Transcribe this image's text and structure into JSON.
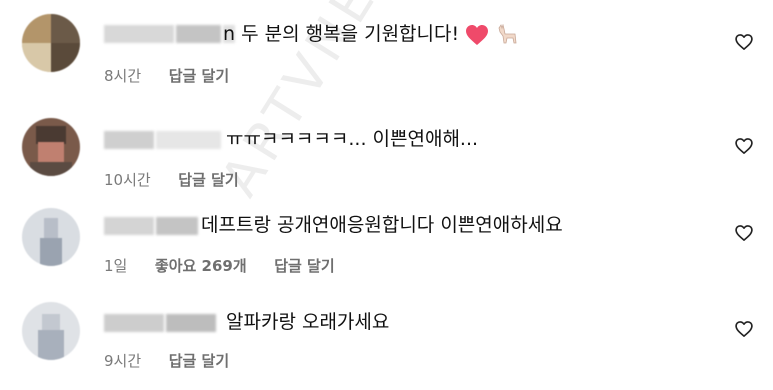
{
  "watermark": "ARTVNEWS",
  "comments": [
    {
      "text": "두 분의 행복을 기원합니다!",
      "username_suffix": "n",
      "time": "8시간",
      "reply_label": "답글 달기",
      "like_icon": "heart-outline-icon"
    },
    {
      "text": "ㅠㅠㅋㅋㅋㅋㅋ... 이쁜연애해...",
      "time": "10시간",
      "reply_label": "답글 달기",
      "like_icon": "heart-outline-icon"
    },
    {
      "text": "데프트랑 공개연애응원합니다 이쁜연애하세요",
      "time": "1일",
      "likes_label": "좋아요 269개",
      "reply_label": "답글 달기",
      "like_icon": "heart-outline-icon"
    },
    {
      "text": "알파카랑 오래가세요",
      "time": "9시간",
      "reply_label": "답글 달기",
      "like_icon": "heart-outline-icon"
    }
  ],
  "colors": {
    "text": "#111111",
    "meta": "#7a7a7a",
    "emoji_heart": "#ef4a6a"
  }
}
